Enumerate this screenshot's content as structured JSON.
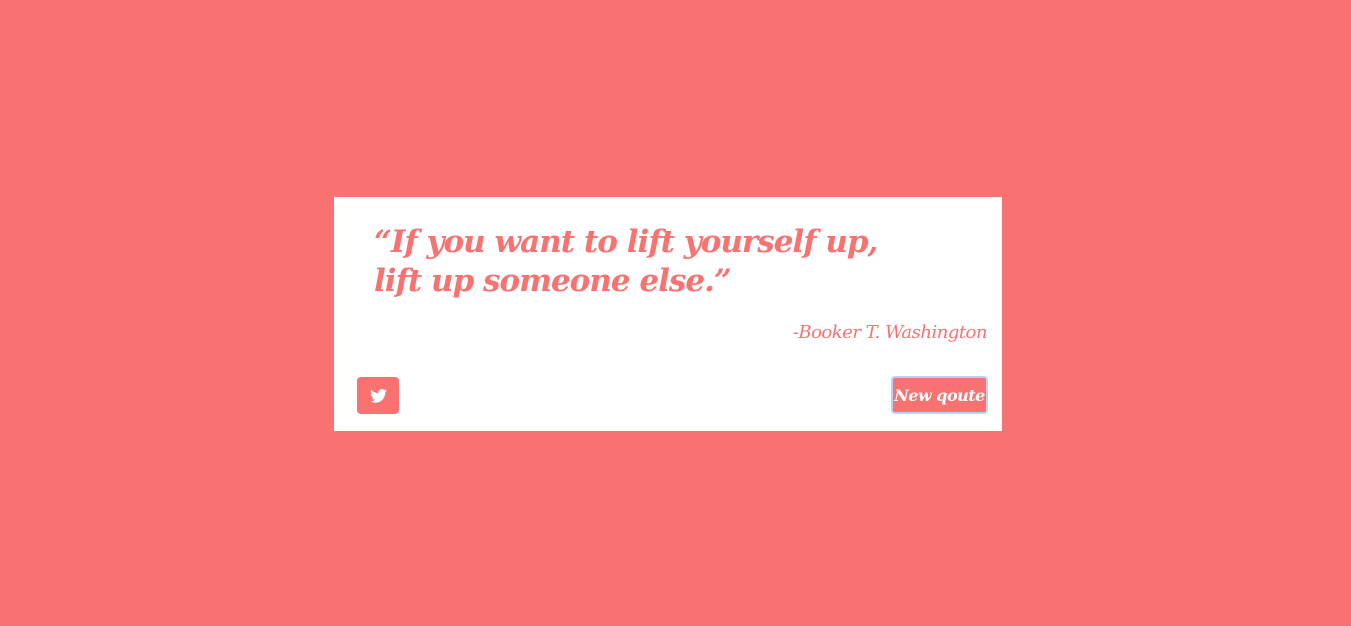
{
  "colors": {
    "background": "#f97272",
    "card": "#ffffff",
    "accent": "#f97272",
    "focus_ring": "#b9d3f5"
  },
  "quote": {
    "text": "“If you want to lift yourself up, lift up someone else.”",
    "author": "-Booker T. Washington"
  },
  "actions": {
    "tweet_icon": "twitter-icon",
    "new_quote_label": "New qoute"
  }
}
